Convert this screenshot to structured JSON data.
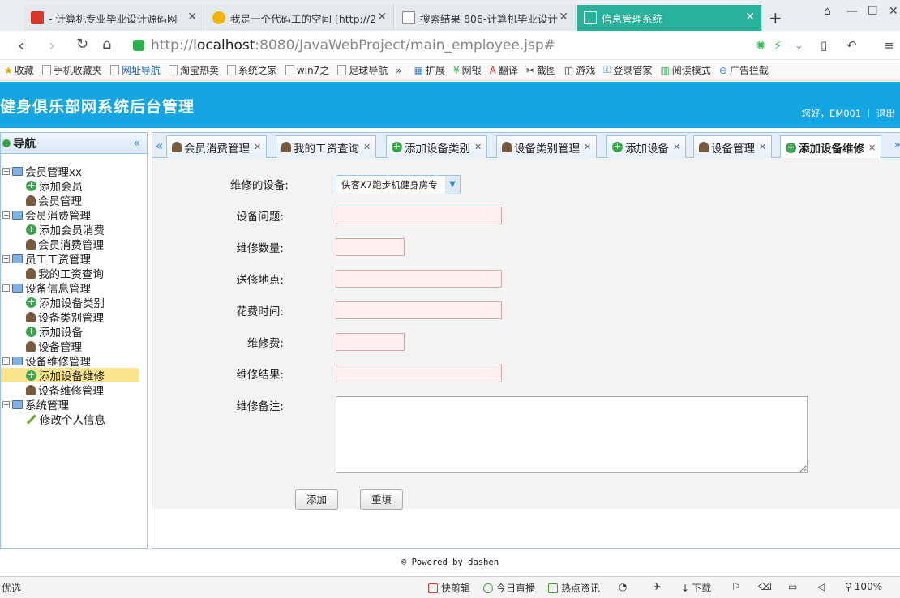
{
  "browser": {
    "tabs": [
      {
        "title": "- 计算机专业毕业设计源码网",
        "icon": "red-site-icon",
        "color": "#d9382a"
      },
      {
        "title": "我是一个代码工的空间 [http://2",
        "icon": "star-icon",
        "color": "#f0b400"
      },
      {
        "title": "搜索结果 806-计算机毕业设计",
        "icon": "document-icon",
        "color": "#888888"
      },
      {
        "title": "信息管理系统",
        "icon": "document-icon",
        "color": "#ffffff",
        "active": true
      }
    ],
    "url_scheme": "http://",
    "url_host": "localhost",
    "url_path": ":8080/JavaWebProject/main_employee.jsp#",
    "bookmarks": [
      "收藏",
      "手机收藏夹",
      "网址导航",
      "淘宝热卖",
      "系统之家",
      "win7之",
      "足球导航",
      "»",
      "扩展",
      "网银",
      "翻译",
      "截图",
      "游戏",
      "登录管家",
      "阅读模式",
      "广告拦截"
    ]
  },
  "header": {
    "title": "健身俱乐部网系统后台管理",
    "user_text": "您好，EM001 ｜ 退出",
    "bg_color": "#14a5e3"
  },
  "sidebar": {
    "title": "导航",
    "groups": [
      {
        "label": "会员管理xx",
        "items": [
          {
            "label": "添加会员",
            "icon": "add-icon"
          },
          {
            "label": "会员管理",
            "icon": "user-icon"
          }
        ]
      },
      {
        "label": "会员消费管理",
        "items": [
          {
            "label": "添加会员消费",
            "icon": "add-icon"
          },
          {
            "label": "会员消费管理",
            "icon": "user-icon"
          }
        ]
      },
      {
        "label": "员工工资管理",
        "items": [
          {
            "label": "我的工资查询",
            "icon": "user-icon"
          }
        ]
      },
      {
        "label": "设备信息管理",
        "items": [
          {
            "label": "添加设备类别",
            "icon": "add-icon"
          },
          {
            "label": "设备类别管理",
            "icon": "user-icon"
          },
          {
            "label": "添加设备",
            "icon": "add-icon"
          },
          {
            "label": "设备管理",
            "icon": "user-icon"
          }
        ]
      },
      {
        "label": "设备维修管理",
        "items": [
          {
            "label": "添加设备维修",
            "icon": "add-icon",
            "selected": true
          },
          {
            "label": "设备维修管理",
            "icon": "user-icon"
          }
        ]
      },
      {
        "label": "系统管理",
        "items": [
          {
            "label": "修改个人信息",
            "icon": "pencil-icon"
          }
        ]
      }
    ]
  },
  "content_tabs": [
    {
      "label": "会员消费管理",
      "icon": "user-icon"
    },
    {
      "label": "我的工资查询",
      "icon": "user-icon"
    },
    {
      "label": "添加设备类别",
      "icon": "add-icon"
    },
    {
      "label": "设备类别管理",
      "icon": "user-icon"
    },
    {
      "label": "添加设备",
      "icon": "add-icon"
    },
    {
      "label": "设备管理",
      "icon": "user-icon"
    },
    {
      "label": "添加设备维修",
      "icon": "add-icon",
      "active": true
    }
  ],
  "form": {
    "device_label": "维修的设备:",
    "device_value": "侠客X7跑步机健身房专",
    "problem_label": "设备问题:",
    "quantity_label": "维修数量:",
    "address_label": "送修地点:",
    "duration_label": "花费时间:",
    "fee_label": "维修费:",
    "result_label": "维修结果:",
    "note_label": "维修备注:",
    "submit_label": "添加",
    "reset_label": "重填"
  },
  "footer": {
    "text": "© Powered by dashen"
  },
  "statusbar": {
    "left": "优选",
    "items": [
      "快剪辑",
      "今日直播",
      "热点资讯",
      "下载",
      "100%"
    ]
  }
}
